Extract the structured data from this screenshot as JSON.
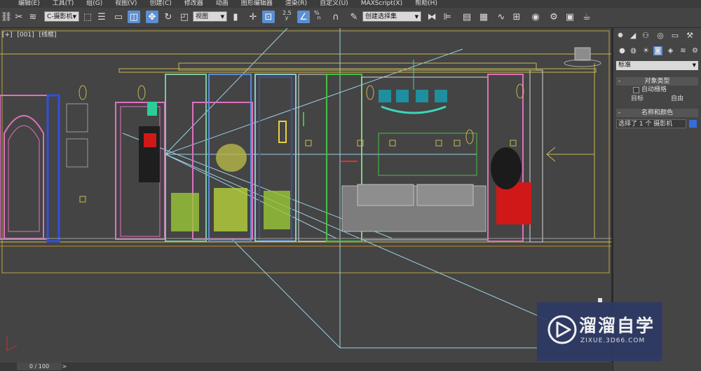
{
  "menubar": {
    "items": [
      "编辑(E)",
      "工具(T)",
      "组(G)",
      "视图(V)",
      "创建(C)",
      "修改器",
      "动画",
      "图形编辑器",
      "渲染(R)",
      "自定义(U)",
      "MAXScript(X)",
      "帮助(H)"
    ]
  },
  "toolbar": {
    "camera_dropdown": "C-摄影机",
    "view_dropdown": "视图",
    "angle_snap": "2.5",
    "percent_snap": "%",
    "selection_set": "创建选择集",
    "colors": {
      "active": "#5b8fd0"
    }
  },
  "viewport": {
    "label_plus": "[+]",
    "label_camera": "[001]",
    "label_shading": "[线框]"
  },
  "panel": {
    "category_select": "标准",
    "object_type": {
      "title": "对象类型",
      "autogrid": "自动栅格",
      "buttons": [
        "目标",
        "自由"
      ]
    },
    "name_color": {
      "title": "名称和颜色",
      "value": "选择了 1 个 摄影机",
      "swatch_color": "#3a6bd8"
    },
    "sign": "-"
  },
  "status": {
    "frame_counter": "0 / 100",
    "arrow": ">"
  },
  "watermark": {
    "title": "溜溜自学",
    "url": "ZIXUE.3D66.COM"
  }
}
